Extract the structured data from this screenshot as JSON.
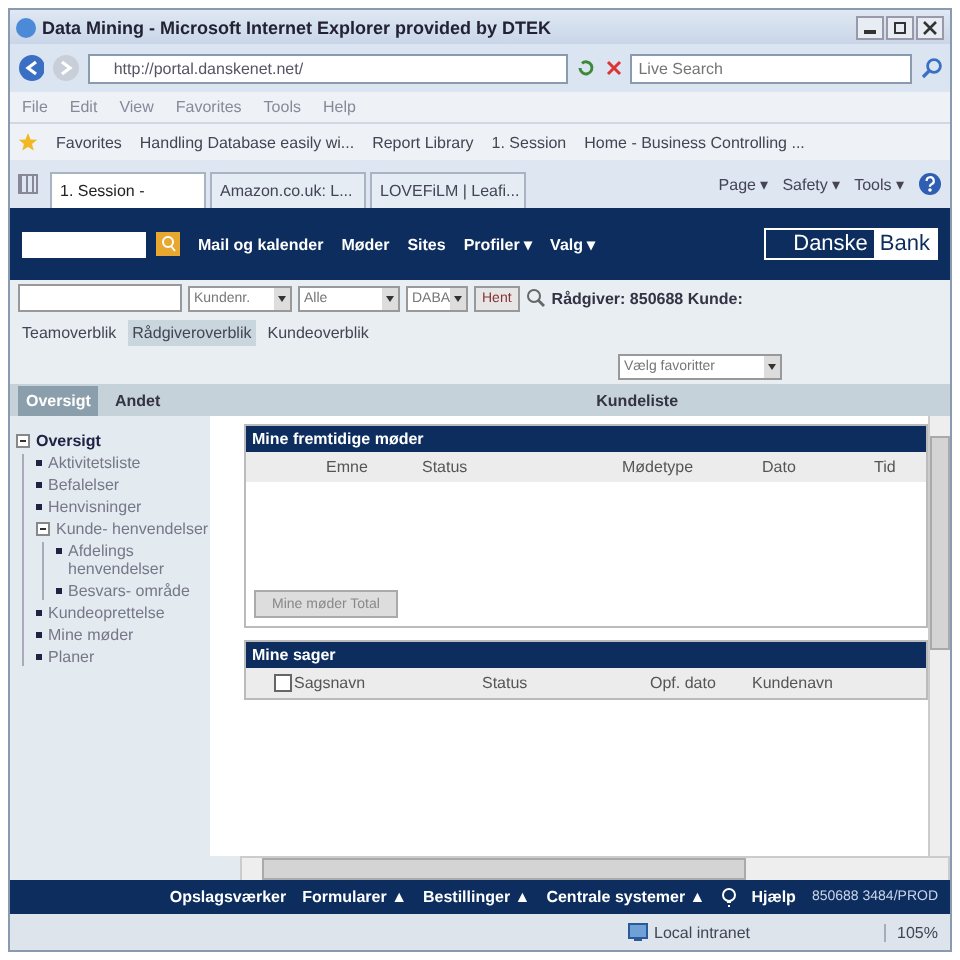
{
  "window": {
    "title": "Data Mining - Microsoft Internet Explorer provided by DTEK"
  },
  "address_bar": {
    "url": "http://portal.danskenet.net/",
    "search_placeholder": "Live Search"
  },
  "menu": [
    "File",
    "Edit",
    "View",
    "Favorites",
    "Tools",
    "Help"
  ],
  "favorites_bar": {
    "label": "Favorites",
    "links": [
      "Handling Database easily wi...",
      "Report Library",
      "1. Session",
      "Home - Business Controlling ..."
    ]
  },
  "browser_tabs": [
    {
      "label": "1. Session -",
      "selected": true
    },
    {
      "label": "Amazon.co.uk: L...",
      "selected": false
    },
    {
      "label": "LOVEFiLM | Leafi...",
      "selected": false
    }
  ],
  "command_bar": [
    "Page ▾",
    "Safety ▾",
    "Tools ▾"
  ],
  "header": {
    "nav": [
      "Mail og kalender",
      "Møder",
      "Sites",
      "Profiler ▾",
      "Valg ▾"
    ],
    "logo": [
      "Danske",
      "Bank"
    ]
  },
  "filter": {
    "selects": [
      "Kundenr.",
      "Alle",
      "DABA"
    ],
    "button": "Hent",
    "info": "Rådgiver: 850688 Kunde:"
  },
  "views": [
    {
      "label": "Teamoverblik",
      "selected": false
    },
    {
      "label": "Rådgiveroverblik",
      "selected": true
    },
    {
      "label": "Kundeoverblik",
      "selected": false
    }
  ],
  "favorites_select": "Vælg favoritter",
  "page_tabs": [
    {
      "label": "Oversigt",
      "selected": true
    },
    {
      "label": "Andet",
      "selected": false
    }
  ],
  "page_title": "Kundeliste",
  "tree": [
    {
      "label": "Oversigt",
      "expanded": true,
      "children": [
        {
          "label": "Aktivitetsliste"
        },
        {
          "label": "Befalelser"
        },
        {
          "label": "Henvisninger"
        },
        {
          "label": "Kunde- henvendelser",
          "expanded": true,
          "children": [
            {
              "label": "Afdelings henvendelser"
            },
            {
              "label": "Besvars- område"
            }
          ]
        },
        {
          "label": "Kundeoprettelse"
        },
        {
          "label": "Mine møder"
        },
        {
          "label": "Planer"
        }
      ]
    }
  ],
  "meetings": {
    "title": "Mine fremtidige møder",
    "columns": [
      "Emne",
      "Status",
      "Mødetype",
      "Dato",
      "Tid"
    ],
    "button": "Mine møder Total"
  },
  "cases": {
    "title": "Mine sager",
    "columns": [
      "Sagsnavn",
      "Status",
      "Opf. dato",
      "Kundenavn"
    ],
    "select_all_checked": false
  },
  "footer": {
    "links": [
      "Opslagsværker",
      "Formularer ▲",
      "Bestillinger ▲",
      "Centrale systemer ▲"
    ],
    "help": "Hjælp",
    "user": "850688 3484/PROD"
  },
  "status_bar": {
    "zone": "Local intranet",
    "zoom": "105%"
  }
}
